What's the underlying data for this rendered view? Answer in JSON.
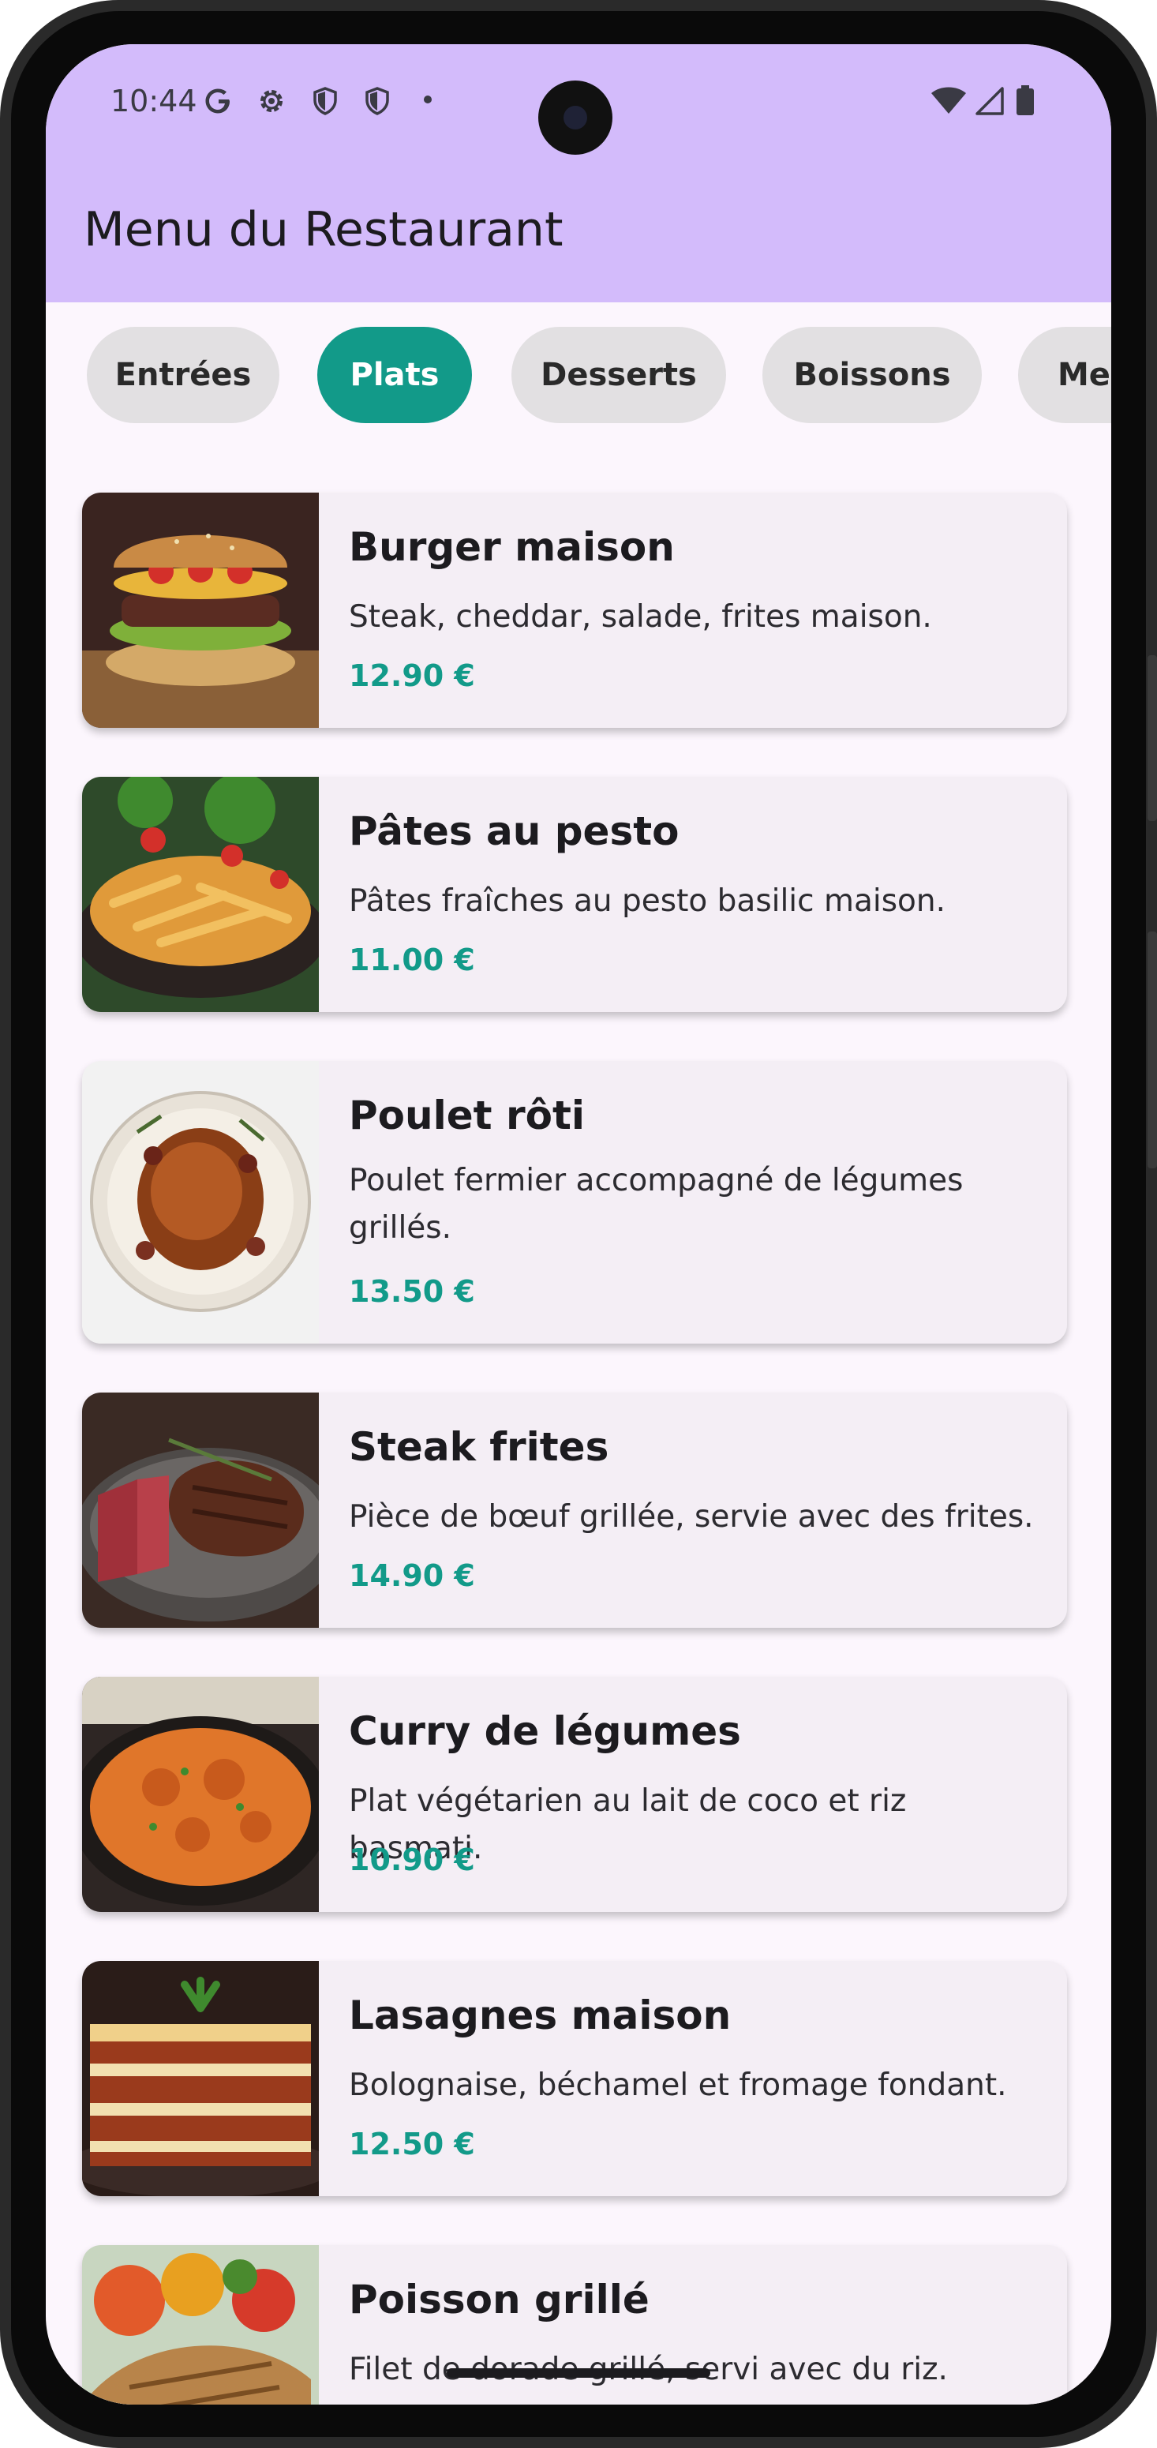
{
  "status_bar": {
    "time": "10:44",
    "left_icons": [
      "google-icon",
      "settings-icon",
      "shield-icon",
      "shield-icon",
      "dot-icon"
    ],
    "right_icons": [
      "wifi-icon",
      "signal-icon",
      "battery-icon"
    ]
  },
  "app_bar": {
    "title": "Menu du Restaurant",
    "color": "#d3bbfb"
  },
  "categories": [
    {
      "label": "Entrées",
      "active": false
    },
    {
      "label": "Plats",
      "active": true
    },
    {
      "label": "Desserts",
      "active": false
    },
    {
      "label": "Boissons",
      "active": false
    },
    {
      "label": "Me",
      "active": false
    }
  ],
  "accent_color": "#129a89",
  "dishes": [
    {
      "name": "Burger maison",
      "description": "Steak, cheddar, salade, frites maison.",
      "price": "12.90 €",
      "image": "burger-image"
    },
    {
      "name": "Pâtes au pesto",
      "description": "Pâtes fraîches au pesto basilic maison.",
      "price": "11.00 €",
      "image": "pasta-image"
    },
    {
      "name": "Poulet rôti",
      "description": "Poulet fermier accompagné de légumes grillés.",
      "price": "13.50 €",
      "image": "roast-chicken-image"
    },
    {
      "name": "Steak frites",
      "description": "Pièce de bœuf grillée, servie avec des frites.",
      "price": "14.90 €",
      "image": "steak-image"
    },
    {
      "name": "Curry de légumes",
      "description": "Plat végétarien au lait de coco et riz basmati.",
      "price": "10.90 €",
      "image": "curry-image"
    },
    {
      "name": "Lasagnes maison",
      "description": "Bolognaise, béchamel et fromage fondant.",
      "price": "12.50 €",
      "image": "lasagna-image"
    },
    {
      "name": "Poisson grillé",
      "description": "Filet de dorade grillé, servi avec du riz.",
      "price": "",
      "image": "grilled-fish-image"
    }
  ]
}
